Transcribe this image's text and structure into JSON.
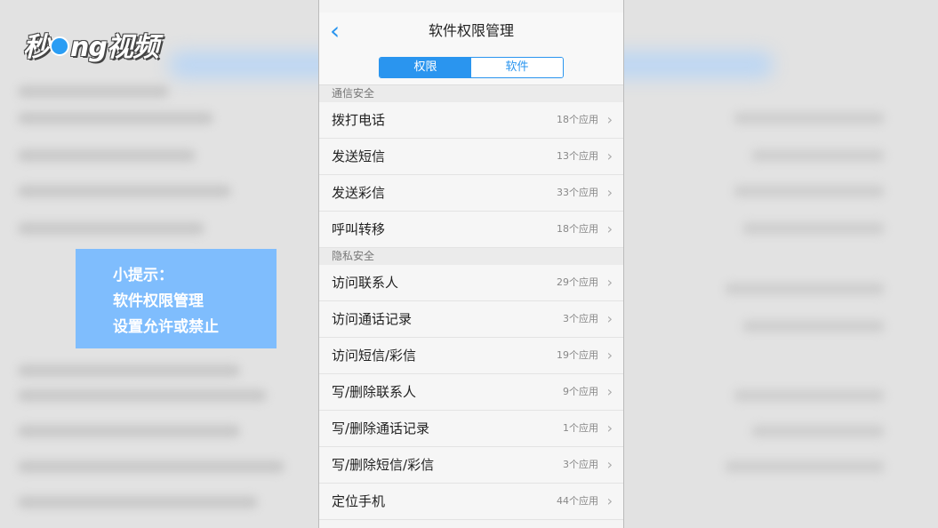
{
  "logo": {
    "part1": "秒",
    "part2": "ng视频"
  },
  "tip": {
    "line1": "小提示：",
    "line2": "软件权限管理",
    "line3": "设置允许或禁止"
  },
  "nav": {
    "back_icon": "chevron-left-icon",
    "title": "软件权限管理"
  },
  "tabs": [
    {
      "label": "权限",
      "active": true
    },
    {
      "label": "软件",
      "active": false
    }
  ],
  "sections": [
    {
      "title": "通信安全",
      "items": [
        {
          "label": "拨打电话",
          "count": "18个应用"
        },
        {
          "label": "发送短信",
          "count": "13个应用"
        },
        {
          "label": "发送彩信",
          "count": "33个应用"
        },
        {
          "label": "呼叫转移",
          "count": "18个应用"
        }
      ]
    },
    {
      "title": "隐私安全",
      "items": [
        {
          "label": "访问联系人",
          "count": "29个应用"
        },
        {
          "label": "访问通话记录",
          "count": "3个应用"
        },
        {
          "label": "访问短信/彩信",
          "count": "19个应用"
        },
        {
          "label": "写/删除联系人",
          "count": "9个应用"
        },
        {
          "label": "写/删除通话记录",
          "count": "1个应用"
        },
        {
          "label": "写/删除短信/彩信",
          "count": "3个应用"
        },
        {
          "label": "定位手机",
          "count": "44个应用"
        }
      ]
    }
  ],
  "colors": {
    "accent": "#2a95ef",
    "tip_bg": "#7fbdfd"
  }
}
